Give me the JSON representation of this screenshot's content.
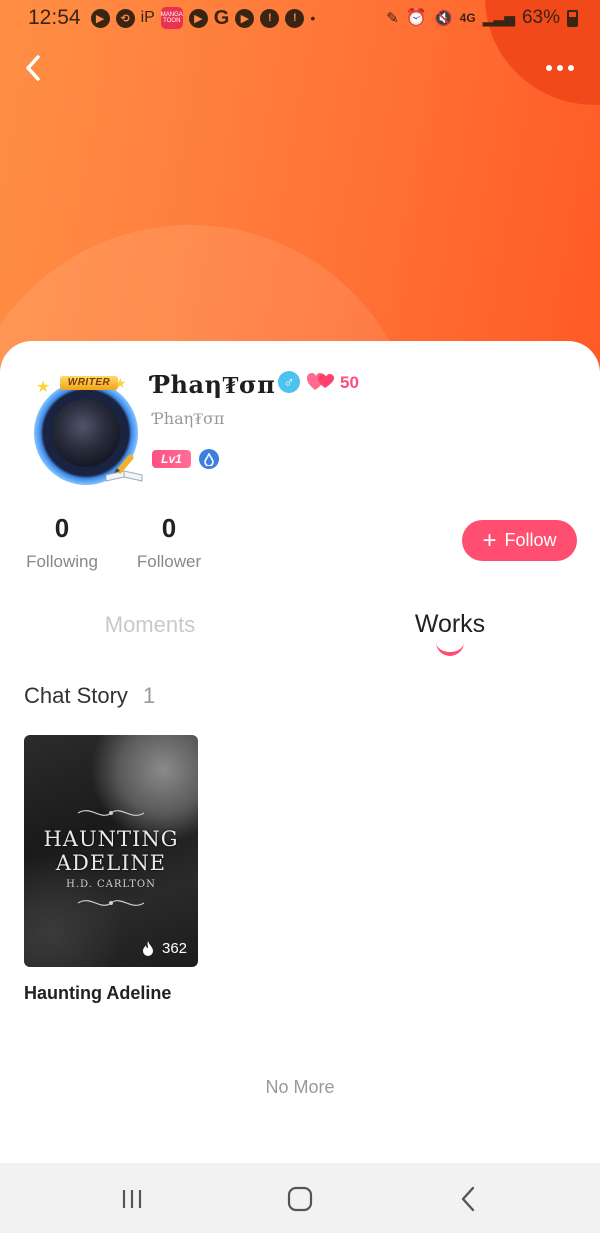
{
  "status_bar": {
    "time": "12:54",
    "battery": "63%",
    "network": "4G",
    "manga_app_label": "MANGA TOON"
  },
  "profile": {
    "username": "Ƥhaη₮σπ",
    "handle": "Ƥhaη₮σπ",
    "hearts": "50",
    "writer_badge": "WRITER",
    "level": "Lv1",
    "gender_symbol": "♂"
  },
  "stats": {
    "following_count": "0",
    "following_label": "Following",
    "follower_count": "0",
    "follower_label": "Follower"
  },
  "follow_button": {
    "icon": "+",
    "label": "Follow"
  },
  "tabs": [
    {
      "label": "Moments",
      "active": false
    },
    {
      "label": "Works",
      "active": true
    }
  ],
  "section": {
    "title": "Chat Story",
    "count": "1"
  },
  "works": [
    {
      "title": "Haunting Adeline",
      "cover_title_line1": "HAUNTING",
      "cover_title_line2": "ADELINE",
      "cover_author": "H.D. CARLTON",
      "reads": "362"
    }
  ],
  "footer_text": "No More",
  "colors": {
    "accent": "#ff4e70",
    "header_start": "#ff8f45",
    "header_end": "#ff5a25"
  },
  "icons": {
    "back": "chevron-left-icon",
    "more": "more-horizontal-icon",
    "gender": "male-icon",
    "hearts": "hearts-icon",
    "drop": "water-drop-icon",
    "fire": "fire-icon"
  }
}
